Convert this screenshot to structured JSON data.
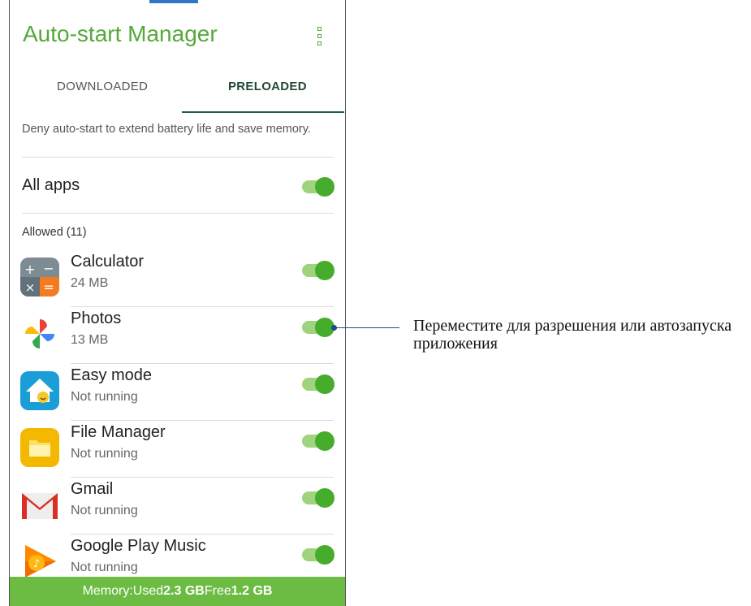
{
  "app": {
    "title": "Auto-start Manager",
    "menu_icon": "more-vert-icon"
  },
  "tabs": [
    {
      "label": "DOWNLOADED",
      "active": false
    },
    {
      "label": "PRELOADED",
      "active": true
    }
  ],
  "hint_text": "Deny auto-start to extend battery life and save memory.",
  "all_apps": {
    "label": "All apps",
    "enabled": true
  },
  "section_label": "Allowed (11)",
  "apps": [
    {
      "name": "Calculator",
      "subtitle": "24 MB",
      "icon": "calculator-icon",
      "enabled": true
    },
    {
      "name": "Photos",
      "subtitle": "13 MB",
      "icon": "photos-pinwheel-icon",
      "enabled": true
    },
    {
      "name": "Easy mode",
      "subtitle": "Not running",
      "icon": "easy-mode-house-icon",
      "enabled": true
    },
    {
      "name": "File Manager",
      "subtitle": "Not running",
      "icon": "folder-icon",
      "enabled": true
    },
    {
      "name": "Gmail",
      "subtitle": "Not running",
      "icon": "gmail-envelope-icon",
      "enabled": true
    },
    {
      "name": "Google Play Music",
      "subtitle": "Not running",
      "icon": "play-music-icon",
      "enabled": true
    }
  ],
  "footer": {
    "memory_label": "Memory:",
    "used_label": "Used",
    "used_value": "2.3 GB",
    "free_label": "Free",
    "free_value": "1.2 GB"
  },
  "annotation": {
    "text": "Переместите для разрешения или автозапуска приложения"
  },
  "colors": {
    "accent_green": "#55a83a",
    "toggle_on": "#46ac2c",
    "footer_bg": "#6cbb43",
    "annotation_line": "#1d4e8c"
  }
}
